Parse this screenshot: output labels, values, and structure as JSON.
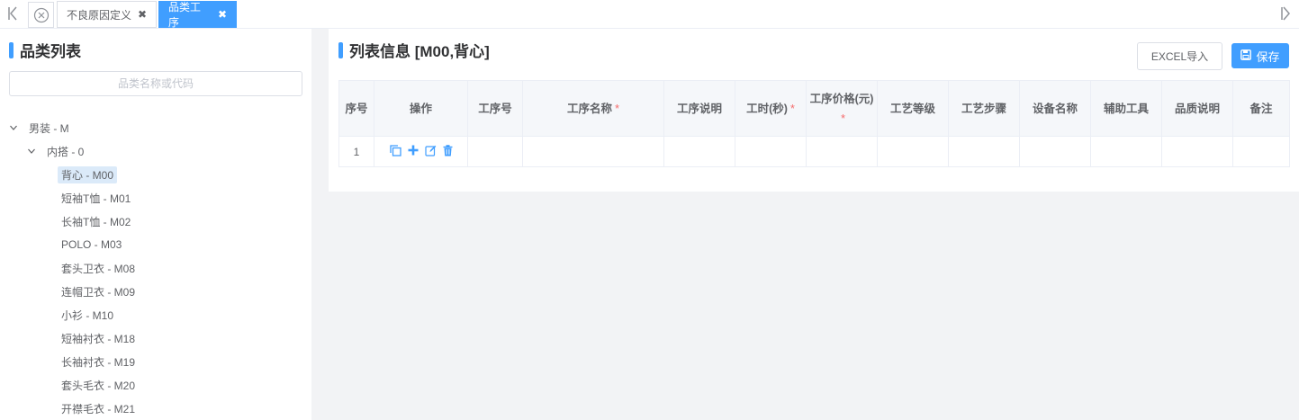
{
  "tabbar": {
    "tabs": [
      {
        "label": "不良原因定义",
        "active": false
      },
      {
        "label": "品类工序",
        "active": true
      }
    ]
  },
  "sidebar": {
    "title": "品类列表",
    "search_placeholder": "品类名称或代码",
    "tree": [
      {
        "label": "男装 - M",
        "level": 0,
        "expanded": true
      },
      {
        "label": "内搭 - 0",
        "level": 1,
        "expanded": true
      },
      {
        "label": "背心 - M00",
        "level": 2,
        "selected": true
      },
      {
        "label": "短袖T恤 - M01",
        "level": 2
      },
      {
        "label": "长袖T恤 - M02",
        "level": 2
      },
      {
        "label": "POLO - M03",
        "level": 2
      },
      {
        "label": "套头卫衣 - M08",
        "level": 2
      },
      {
        "label": "连帽卫衣 - M09",
        "level": 2
      },
      {
        "label": "小衫 - M10",
        "level": 2
      },
      {
        "label": "短袖衬衣 - M18",
        "level": 2
      },
      {
        "label": "长袖衬衣 - M19",
        "level": 2
      },
      {
        "label": "套头毛衣 - M20",
        "level": 2
      },
      {
        "label": "开襟毛衣 - M21",
        "level": 2
      }
    ]
  },
  "main": {
    "title": "列表信息 [M00,背心]",
    "import_label": "EXCEL导入",
    "save_label": "保存",
    "columns": [
      {
        "label": "序号"
      },
      {
        "label": "操作"
      },
      {
        "label": "工序号"
      },
      {
        "label": "工序名称",
        "required": true
      },
      {
        "label": "工序说明"
      },
      {
        "label": "工时(秒)",
        "required": true
      },
      {
        "label": "工序价格(元)",
        "required": true
      },
      {
        "label": "工艺等级"
      },
      {
        "label": "工艺步骤"
      },
      {
        "label": "设备名称"
      },
      {
        "label": "辅助工具"
      },
      {
        "label": "品质说明"
      },
      {
        "label": "备注"
      }
    ],
    "rows": [
      {
        "index": "1"
      }
    ],
    "required_mark": "*"
  },
  "colors": {
    "accent": "#409eff",
    "required": "#f56c6c",
    "selected_bg": "#dbeaf9"
  }
}
